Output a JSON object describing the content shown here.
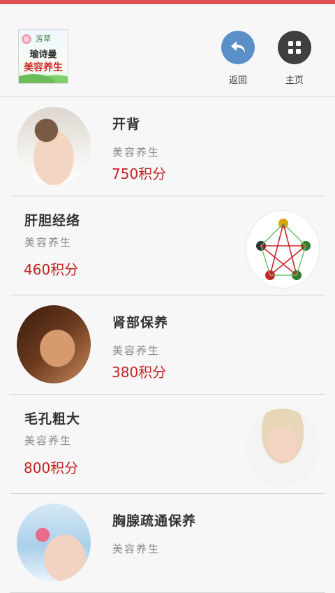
{
  "header": {
    "logo": {
      "line1": "芳草",
      "line2": "瑜诗曼",
      "line3": "美容养生"
    },
    "back_label": "返回",
    "home_label": "主页"
  },
  "items": [
    {
      "title": "开背",
      "category": "美容养生",
      "points": "750积分"
    },
    {
      "title": "肝胆经络",
      "category": "美容养生",
      "points": "460积分"
    },
    {
      "title": "肾部保养",
      "category": "美容养生",
      "points": "380积分"
    },
    {
      "title": "毛孔粗大",
      "category": "美容养生",
      "points": "800积分"
    },
    {
      "title": "胸腺疏通保养",
      "category": "美容养生",
      "points": ""
    }
  ],
  "icons": {
    "back": "back-arrow-icon",
    "home": "grid-icon"
  },
  "colors": {
    "accent_bar": "#e05252",
    "back_button": "#5a8fc7",
    "home_button": "#3f3f3f",
    "points_red": "#c42222"
  }
}
